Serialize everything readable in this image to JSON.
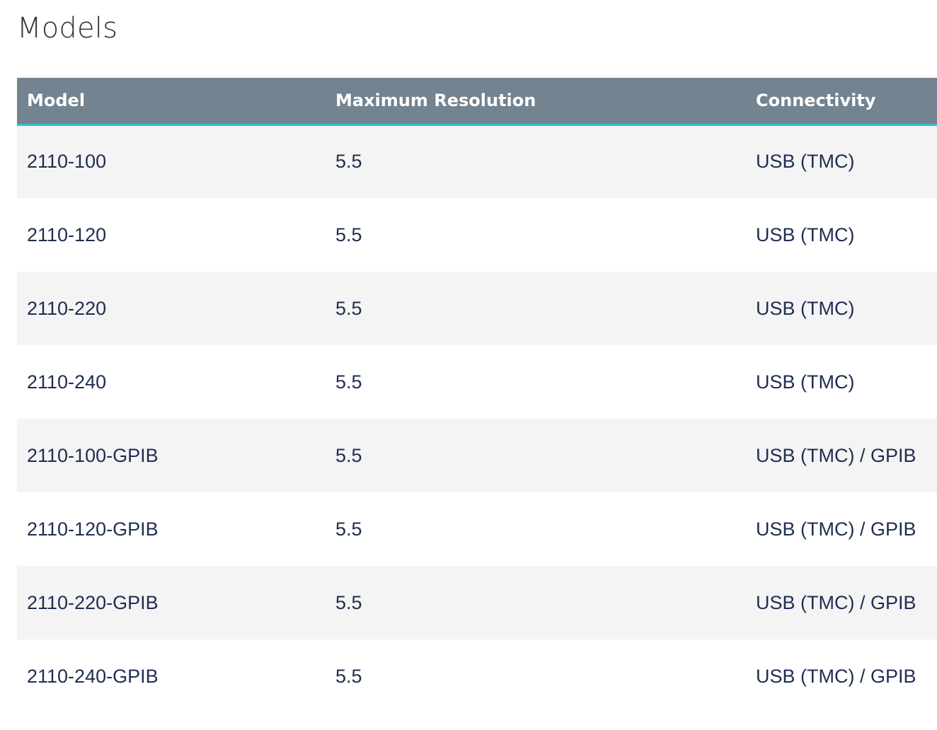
{
  "page": {
    "title": "Models"
  },
  "table": {
    "headers": [
      "Model",
      "Maximum Resolution",
      "Connectivity"
    ],
    "rows": [
      [
        "2110-100",
        "5.5",
        "USB (TMC)"
      ],
      [
        "2110-120",
        "5.5",
        "USB (TMC)"
      ],
      [
        "2110-220",
        "5.5",
        "USB (TMC)"
      ],
      [
        "2110-240",
        "5.5",
        "USB (TMC)"
      ],
      [
        "2110-100-GPIB",
        "5.5",
        "USB (TMC) / GPIB"
      ],
      [
        "2110-120-GPIB",
        "5.5",
        "USB (TMC) / GPIB"
      ],
      [
        "2110-220-GPIB",
        "5.5",
        "USB (TMC) / GPIB"
      ],
      [
        "2110-240-GPIB",
        "5.5",
        "USB (TMC) / GPIB"
      ]
    ]
  },
  "colors": {
    "header_background": "#73838f",
    "header_accent": "#2cc0dd",
    "row_stripe": "#f4f4f4",
    "cell_text": "#1f2d52"
  }
}
